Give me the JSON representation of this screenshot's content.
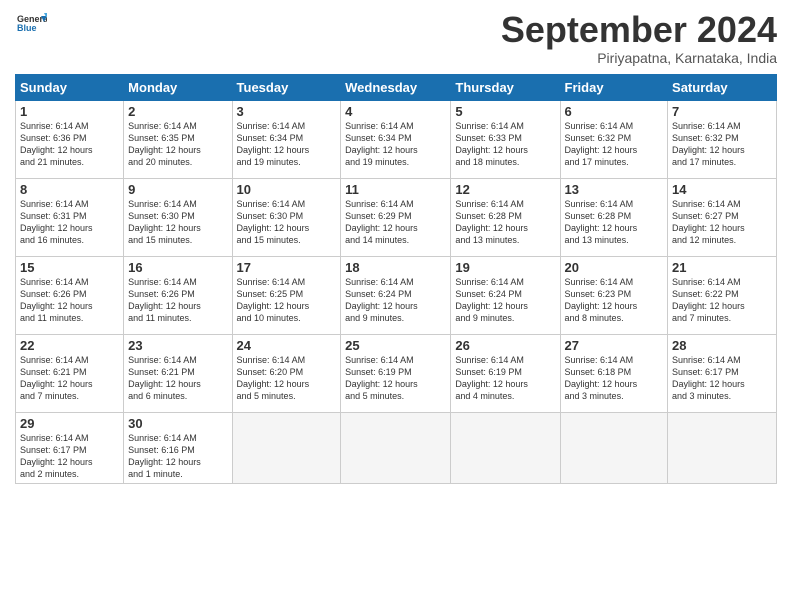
{
  "logo": {
    "general": "General",
    "blue": "Blue"
  },
  "header": {
    "month": "September 2024",
    "location": "Piriyapatna, Karnataka, India"
  },
  "weekdays": [
    "Sunday",
    "Monday",
    "Tuesday",
    "Wednesday",
    "Thursday",
    "Friday",
    "Saturday"
  ],
  "weeks": [
    [
      {
        "day": "1",
        "info": "Sunrise: 6:14 AM\nSunset: 6:36 PM\nDaylight: 12 hours\nand 21 minutes."
      },
      {
        "day": "2",
        "info": "Sunrise: 6:14 AM\nSunset: 6:35 PM\nDaylight: 12 hours\nand 20 minutes."
      },
      {
        "day": "3",
        "info": "Sunrise: 6:14 AM\nSunset: 6:34 PM\nDaylight: 12 hours\nand 19 minutes."
      },
      {
        "day": "4",
        "info": "Sunrise: 6:14 AM\nSunset: 6:34 PM\nDaylight: 12 hours\nand 19 minutes."
      },
      {
        "day": "5",
        "info": "Sunrise: 6:14 AM\nSunset: 6:33 PM\nDaylight: 12 hours\nand 18 minutes."
      },
      {
        "day": "6",
        "info": "Sunrise: 6:14 AM\nSunset: 6:32 PM\nDaylight: 12 hours\nand 17 minutes."
      },
      {
        "day": "7",
        "info": "Sunrise: 6:14 AM\nSunset: 6:32 PM\nDaylight: 12 hours\nand 17 minutes."
      }
    ],
    [
      {
        "day": "8",
        "info": "Sunrise: 6:14 AM\nSunset: 6:31 PM\nDaylight: 12 hours\nand 16 minutes."
      },
      {
        "day": "9",
        "info": "Sunrise: 6:14 AM\nSunset: 6:30 PM\nDaylight: 12 hours\nand 15 minutes."
      },
      {
        "day": "10",
        "info": "Sunrise: 6:14 AM\nSunset: 6:30 PM\nDaylight: 12 hours\nand 15 minutes."
      },
      {
        "day": "11",
        "info": "Sunrise: 6:14 AM\nSunset: 6:29 PM\nDaylight: 12 hours\nand 14 minutes."
      },
      {
        "day": "12",
        "info": "Sunrise: 6:14 AM\nSunset: 6:28 PM\nDaylight: 12 hours\nand 13 minutes."
      },
      {
        "day": "13",
        "info": "Sunrise: 6:14 AM\nSunset: 6:28 PM\nDaylight: 12 hours\nand 13 minutes."
      },
      {
        "day": "14",
        "info": "Sunrise: 6:14 AM\nSunset: 6:27 PM\nDaylight: 12 hours\nand 12 minutes."
      }
    ],
    [
      {
        "day": "15",
        "info": "Sunrise: 6:14 AM\nSunset: 6:26 PM\nDaylight: 12 hours\nand 11 minutes."
      },
      {
        "day": "16",
        "info": "Sunrise: 6:14 AM\nSunset: 6:26 PM\nDaylight: 12 hours\nand 11 minutes."
      },
      {
        "day": "17",
        "info": "Sunrise: 6:14 AM\nSunset: 6:25 PM\nDaylight: 12 hours\nand 10 minutes."
      },
      {
        "day": "18",
        "info": "Sunrise: 6:14 AM\nSunset: 6:24 PM\nDaylight: 12 hours\nand 9 minutes."
      },
      {
        "day": "19",
        "info": "Sunrise: 6:14 AM\nSunset: 6:24 PM\nDaylight: 12 hours\nand 9 minutes."
      },
      {
        "day": "20",
        "info": "Sunrise: 6:14 AM\nSunset: 6:23 PM\nDaylight: 12 hours\nand 8 minutes."
      },
      {
        "day": "21",
        "info": "Sunrise: 6:14 AM\nSunset: 6:22 PM\nDaylight: 12 hours\nand 7 minutes."
      }
    ],
    [
      {
        "day": "22",
        "info": "Sunrise: 6:14 AM\nSunset: 6:21 PM\nDaylight: 12 hours\nand 7 minutes."
      },
      {
        "day": "23",
        "info": "Sunrise: 6:14 AM\nSunset: 6:21 PM\nDaylight: 12 hours\nand 6 minutes."
      },
      {
        "day": "24",
        "info": "Sunrise: 6:14 AM\nSunset: 6:20 PM\nDaylight: 12 hours\nand 5 minutes."
      },
      {
        "day": "25",
        "info": "Sunrise: 6:14 AM\nSunset: 6:19 PM\nDaylight: 12 hours\nand 5 minutes."
      },
      {
        "day": "26",
        "info": "Sunrise: 6:14 AM\nSunset: 6:19 PM\nDaylight: 12 hours\nand 4 minutes."
      },
      {
        "day": "27",
        "info": "Sunrise: 6:14 AM\nSunset: 6:18 PM\nDaylight: 12 hours\nand 3 minutes."
      },
      {
        "day": "28",
        "info": "Sunrise: 6:14 AM\nSunset: 6:17 PM\nDaylight: 12 hours\nand 3 minutes."
      }
    ],
    [
      {
        "day": "29",
        "info": "Sunrise: 6:14 AM\nSunset: 6:17 PM\nDaylight: 12 hours\nand 2 minutes."
      },
      {
        "day": "30",
        "info": "Sunrise: 6:14 AM\nSunset: 6:16 PM\nDaylight: 12 hours\nand 1 minute."
      },
      {
        "day": "",
        "info": ""
      },
      {
        "day": "",
        "info": ""
      },
      {
        "day": "",
        "info": ""
      },
      {
        "day": "",
        "info": ""
      },
      {
        "day": "",
        "info": ""
      }
    ]
  ]
}
